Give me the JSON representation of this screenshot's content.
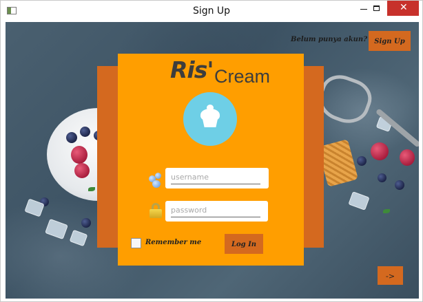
{
  "window": {
    "title": "Sign Up",
    "controls": {
      "minimize": "minimize-icon",
      "maximize": "maximize-icon",
      "close": "close-icon",
      "close_glyph": "✕"
    }
  },
  "header": {
    "prompt": "Belum punya akun?",
    "signup_label": "Sign Up"
  },
  "card": {
    "logo_main": "Ris'",
    "logo_sub": "Cream",
    "avatar_icon": "ice-cream-icon",
    "username_placeholder": "username",
    "username_icon": "users-icon",
    "password_placeholder": "password",
    "password_icon": "lock-icon",
    "remember_label": "Remember me",
    "remember_checked": false,
    "login_label": "Log In"
  },
  "footer": {
    "next_label": "->"
  },
  "colors": {
    "card": "#ff9e00",
    "card_back": "#d4691f",
    "button": "#d4691f",
    "avatar": "#6ecfe6",
    "close": "#c7312b"
  }
}
